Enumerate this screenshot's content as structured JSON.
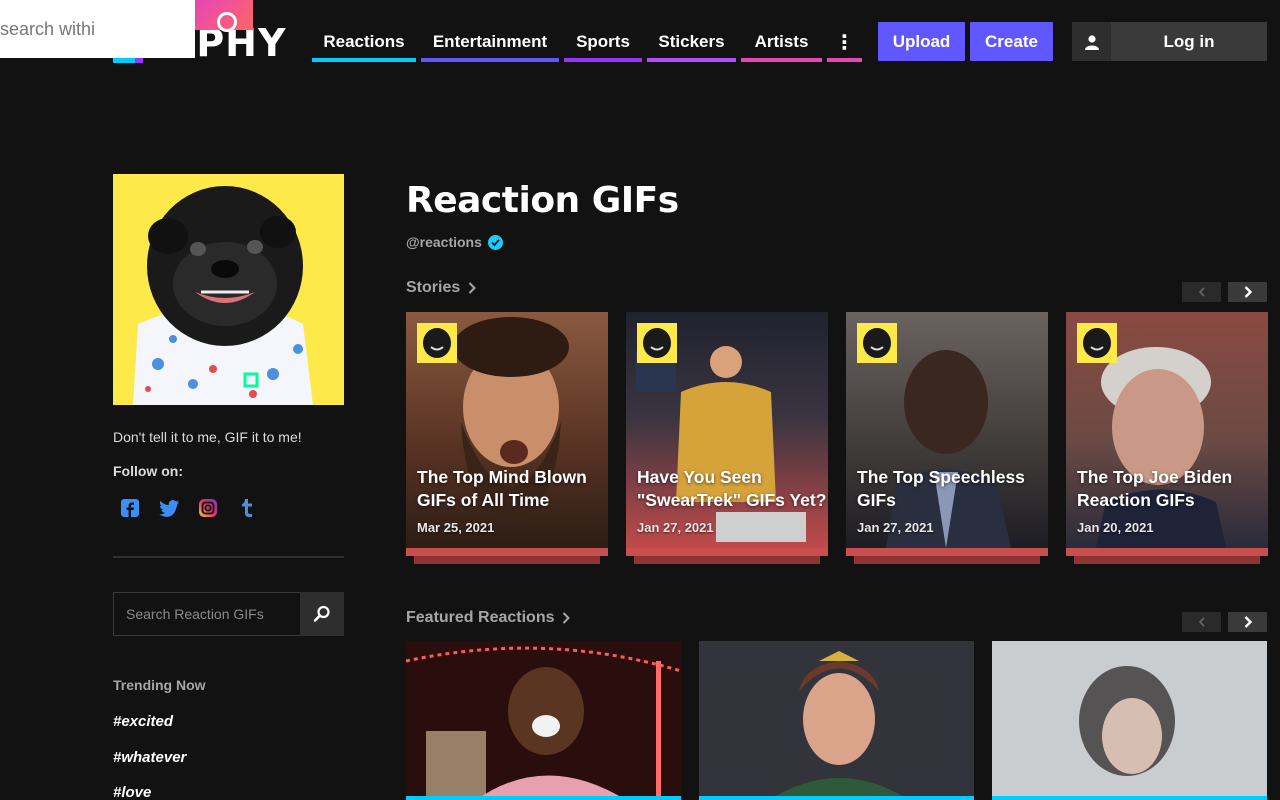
{
  "header": {
    "search_overlay_text": "search withi",
    "logo_text": "GIPHY",
    "nav": [
      {
        "label": "Reactions",
        "color": "#00ccff"
      },
      {
        "label": "Entertainment",
        "color": "#6157ff"
      },
      {
        "label": "Sports",
        "color": "#9933ff"
      },
      {
        "label": "Stickers",
        "color": "#b44cff"
      },
      {
        "label": "Artists",
        "color": "#e646b6"
      },
      {
        "label": "⋮",
        "color": "#e646b6"
      }
    ],
    "upload_label": "Upload",
    "create_label": "Create",
    "login_label": "Log in",
    "accent": "#6157ff"
  },
  "sidebar": {
    "tagline": "Don't tell it to me, GIF it to me!",
    "follow_label": "Follow on:",
    "socials": [
      "facebook-icon",
      "twitter-icon",
      "instagram-icon",
      "tumblr-icon"
    ],
    "search_placeholder": "Search Reaction GIFs",
    "trending_title": "Trending Now",
    "tags": [
      "#excited",
      "#whatever",
      "#love"
    ]
  },
  "main": {
    "title": "Reaction GIFs",
    "handle": "@reactions",
    "stories_label": "Stories",
    "featured_label": "Featured Reactions",
    "stories": [
      {
        "title": "The Top Mind Blown GIFs of All Time",
        "date": "Mar 25, 2021",
        "accent": "#e35d5d",
        "bg": "#6b4030"
      },
      {
        "title": "Have You Seen \"SwearTrek\" GIFs Yet?",
        "date": "Jan 27, 2021",
        "accent": "#e35d5d",
        "bg": "#3a3a40"
      },
      {
        "title": "The Top Speechless GIFs",
        "date": "Jan 27, 2021",
        "accent": "#e35d5d",
        "bg": "#4a4038"
      },
      {
        "title": "The Top Joe Biden Reaction GIFs",
        "date": "Jan 20, 2021",
        "accent": "#e35d5d",
        "bg": "#6e5048"
      }
    ]
  }
}
